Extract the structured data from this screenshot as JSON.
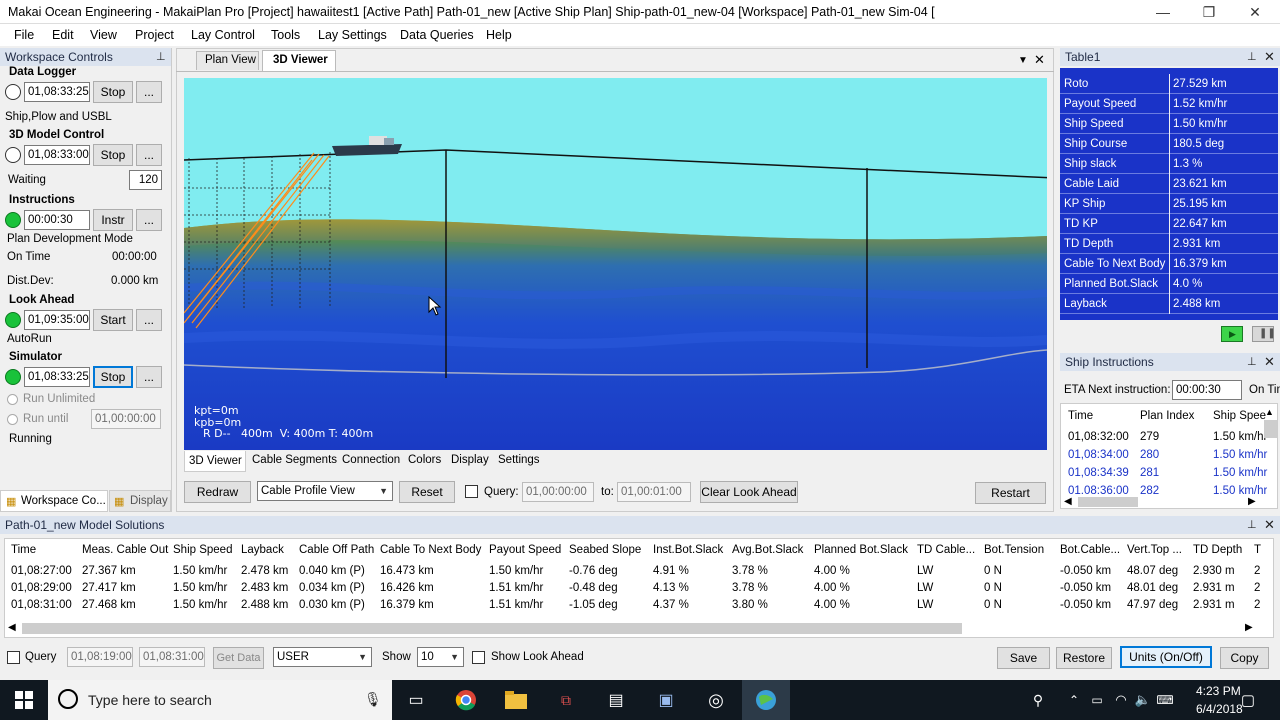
{
  "window": {
    "title": "Makai Ocean Engineering - MakaiPlan Pro [Project] hawaiitest1 [Active Path] Path-01_new [Active Ship Plan] Ship-path-01_new-04 [Workspace] Path-01_new Sim-04 [",
    "minimize": "—",
    "restore": "❐",
    "close": "✕"
  },
  "menu": [
    "File",
    "Edit",
    "View",
    "Project",
    "Lay Control",
    "Tools",
    "Lay Settings",
    "Data Queries",
    "Help"
  ],
  "workspace_controls": {
    "title": "Workspace Controls",
    "pin": "⊥",
    "data_logger": {
      "label": "Data Logger",
      "time": "01,08:33:25",
      "button": "Stop",
      "more": "...",
      "mode": "Ship,Plow and USBL"
    },
    "model_control": {
      "label": "3D Model Control",
      "time": "01,08:33:00",
      "button": "Stop",
      "more": "...",
      "waiting_label": "Waiting",
      "waiting_value": "120"
    },
    "instructions": {
      "label": "Instructions",
      "time": "00:00:30",
      "button": "Instr",
      "more": "...",
      "mode": "Plan Development Mode",
      "on_time_label": "On Time",
      "on_time_value": "00:00:00",
      "dist_dev_label": "Dist.Dev:",
      "dist_dev_value": "0.000 km"
    },
    "look_ahead": {
      "label": "Look Ahead",
      "time": "01,09:35:00",
      "button": "Start",
      "more": "...",
      "mode": "AutoRun"
    },
    "simulator": {
      "label": "Simulator",
      "time": "01,08:33:25",
      "button": "Stop",
      "more": "...",
      "run_unlimited": "Run Unlimited",
      "run_until": "Run until",
      "run_until_time": "01,00:00:00",
      "status": "Running"
    },
    "bottom_tabs": [
      "Workspace Co...",
      "Display"
    ]
  },
  "viewer": {
    "tabs": [
      "Plan View",
      "3D Viewer"
    ],
    "overlay": {
      "kpt": "kpt=0m",
      "kpb": "kpb=0m",
      "rd": "R D--   400m  V: 400m T: 400m"
    },
    "sub_tabs": [
      "3D Viewer",
      "Cable Segments",
      "Connection",
      "Colors",
      "Display",
      "Settings"
    ],
    "redraw": "Redraw",
    "view_select": "Cable Profile View",
    "reset": "Reset",
    "query_label": "Query:",
    "query_from": "01,00:00:00",
    "to_label": "to:",
    "query_to": "01,00:01:00",
    "clear_look_ahead": "Clear Look Ahead",
    "restart": "Restart"
  },
  "table1": {
    "title": "Table1",
    "rows": [
      {
        "k": "Roto",
        "v": "27.529 km"
      },
      {
        "k": "Payout Speed",
        "v": "1.52 km/hr"
      },
      {
        "k": "Ship Speed",
        "v": "1.50 km/hr"
      },
      {
        "k": "Ship Course",
        "v": "180.5 deg"
      },
      {
        "k": "Ship slack",
        "v": "1.3 %"
      },
      {
        "k": "Cable Laid",
        "v": "23.621 km"
      },
      {
        "k": "KP Ship",
        "v": "25.195 km"
      },
      {
        "k": "TD KP",
        "v": "22.647 km"
      },
      {
        "k": "TD Depth",
        "v": "2.931 km"
      },
      {
        "k": "Cable To Next Body",
        "v": "16.379 km"
      },
      {
        "k": "Planned Bot.Slack",
        "v": "4.0 %"
      },
      {
        "k": "Layback",
        "v": "2.488 km"
      }
    ]
  },
  "ship_instructions": {
    "title": "Ship Instructions",
    "eta_label": "ETA Next instruction:",
    "eta_value": "00:00:30",
    "on_time": "On Tim",
    "headers": [
      "Time",
      "Plan Index",
      "Ship Spee"
    ],
    "rows": [
      {
        "time": "01,08:32:00",
        "index": "279",
        "speed": "1.50 km/hr"
      },
      {
        "time": "01,08:34:00",
        "index": "280",
        "speed": "1.50 km/hr"
      },
      {
        "time": "01,08:34:39",
        "index": "281",
        "speed": "1.50 km/hr"
      },
      {
        "time": "01,08:36:00",
        "index": "282",
        "speed": "1.50 km/hr"
      }
    ]
  },
  "model_solutions": {
    "title": "Path-01_new Model Solutions",
    "headers": [
      "Time",
      "Meas. Cable Out",
      "Ship Speed",
      "Layback",
      "Cable Off Path",
      "Cable To Next Body",
      "Payout Speed",
      "Seabed Slope",
      "Inst.Bot.Slack",
      "Avg.Bot.Slack",
      "Planned Bot.Slack",
      "TD Cable...",
      "Bot.Tension",
      "Bot.Cable...",
      "Vert.Top ...",
      "TD Depth",
      "T"
    ],
    "rows": [
      [
        "01,08:27:00",
        "27.367 km",
        "1.50 km/hr",
        "2.478 km",
        "0.040 km (P)",
        "16.473 km",
        "1.50 km/hr",
        "-0.76 deg",
        "4.91 %",
        "3.78 %",
        "4.00 %",
        "LW",
        "0 N",
        "-0.050 km",
        "48.07 deg",
        "2.930 m",
        "2"
      ],
      [
        "01,08:29:00",
        "27.417 km",
        "1.50 km/hr",
        "2.483 km",
        "0.034 km (P)",
        "16.426 km",
        "1.51 km/hr",
        "-0.48 deg",
        "4.13 %",
        "3.78 %",
        "4.00 %",
        "LW",
        "0 N",
        "-0.050 km",
        "48.01 deg",
        "2.931 m",
        "2"
      ],
      [
        "01,08:31:00",
        "27.468 km",
        "1.50 km/hr",
        "2.488 km",
        "0.030 km (P)",
        "16.379 km",
        "1.51 km/hr",
        "-1.05 deg",
        "4.37 %",
        "3.80 %",
        "4.00 %",
        "LW",
        "0 N",
        "-0.050 km",
        "47.97 deg",
        "2.931 m",
        "2"
      ]
    ],
    "query_label": "Query",
    "from": "01,08:19:00",
    "to": "01,08:31:00",
    "get_data": "Get Data",
    "user": "USER",
    "show_label": "Show",
    "show_value": "10",
    "show_look_ahead": "Show Look Ahead",
    "save": "Save",
    "restore": "Restore",
    "units": "Units (On/Off)",
    "copy": "Copy"
  },
  "taskbar": {
    "search_placeholder": "Type here to search",
    "time": "4:23 PM",
    "date": "6/4/2018"
  },
  "colors": {
    "sky": "#80ecf0",
    "sea_deep": "#1a3fd0",
    "table_blue": "#1a33c8",
    "accent": "#0078d7"
  }
}
